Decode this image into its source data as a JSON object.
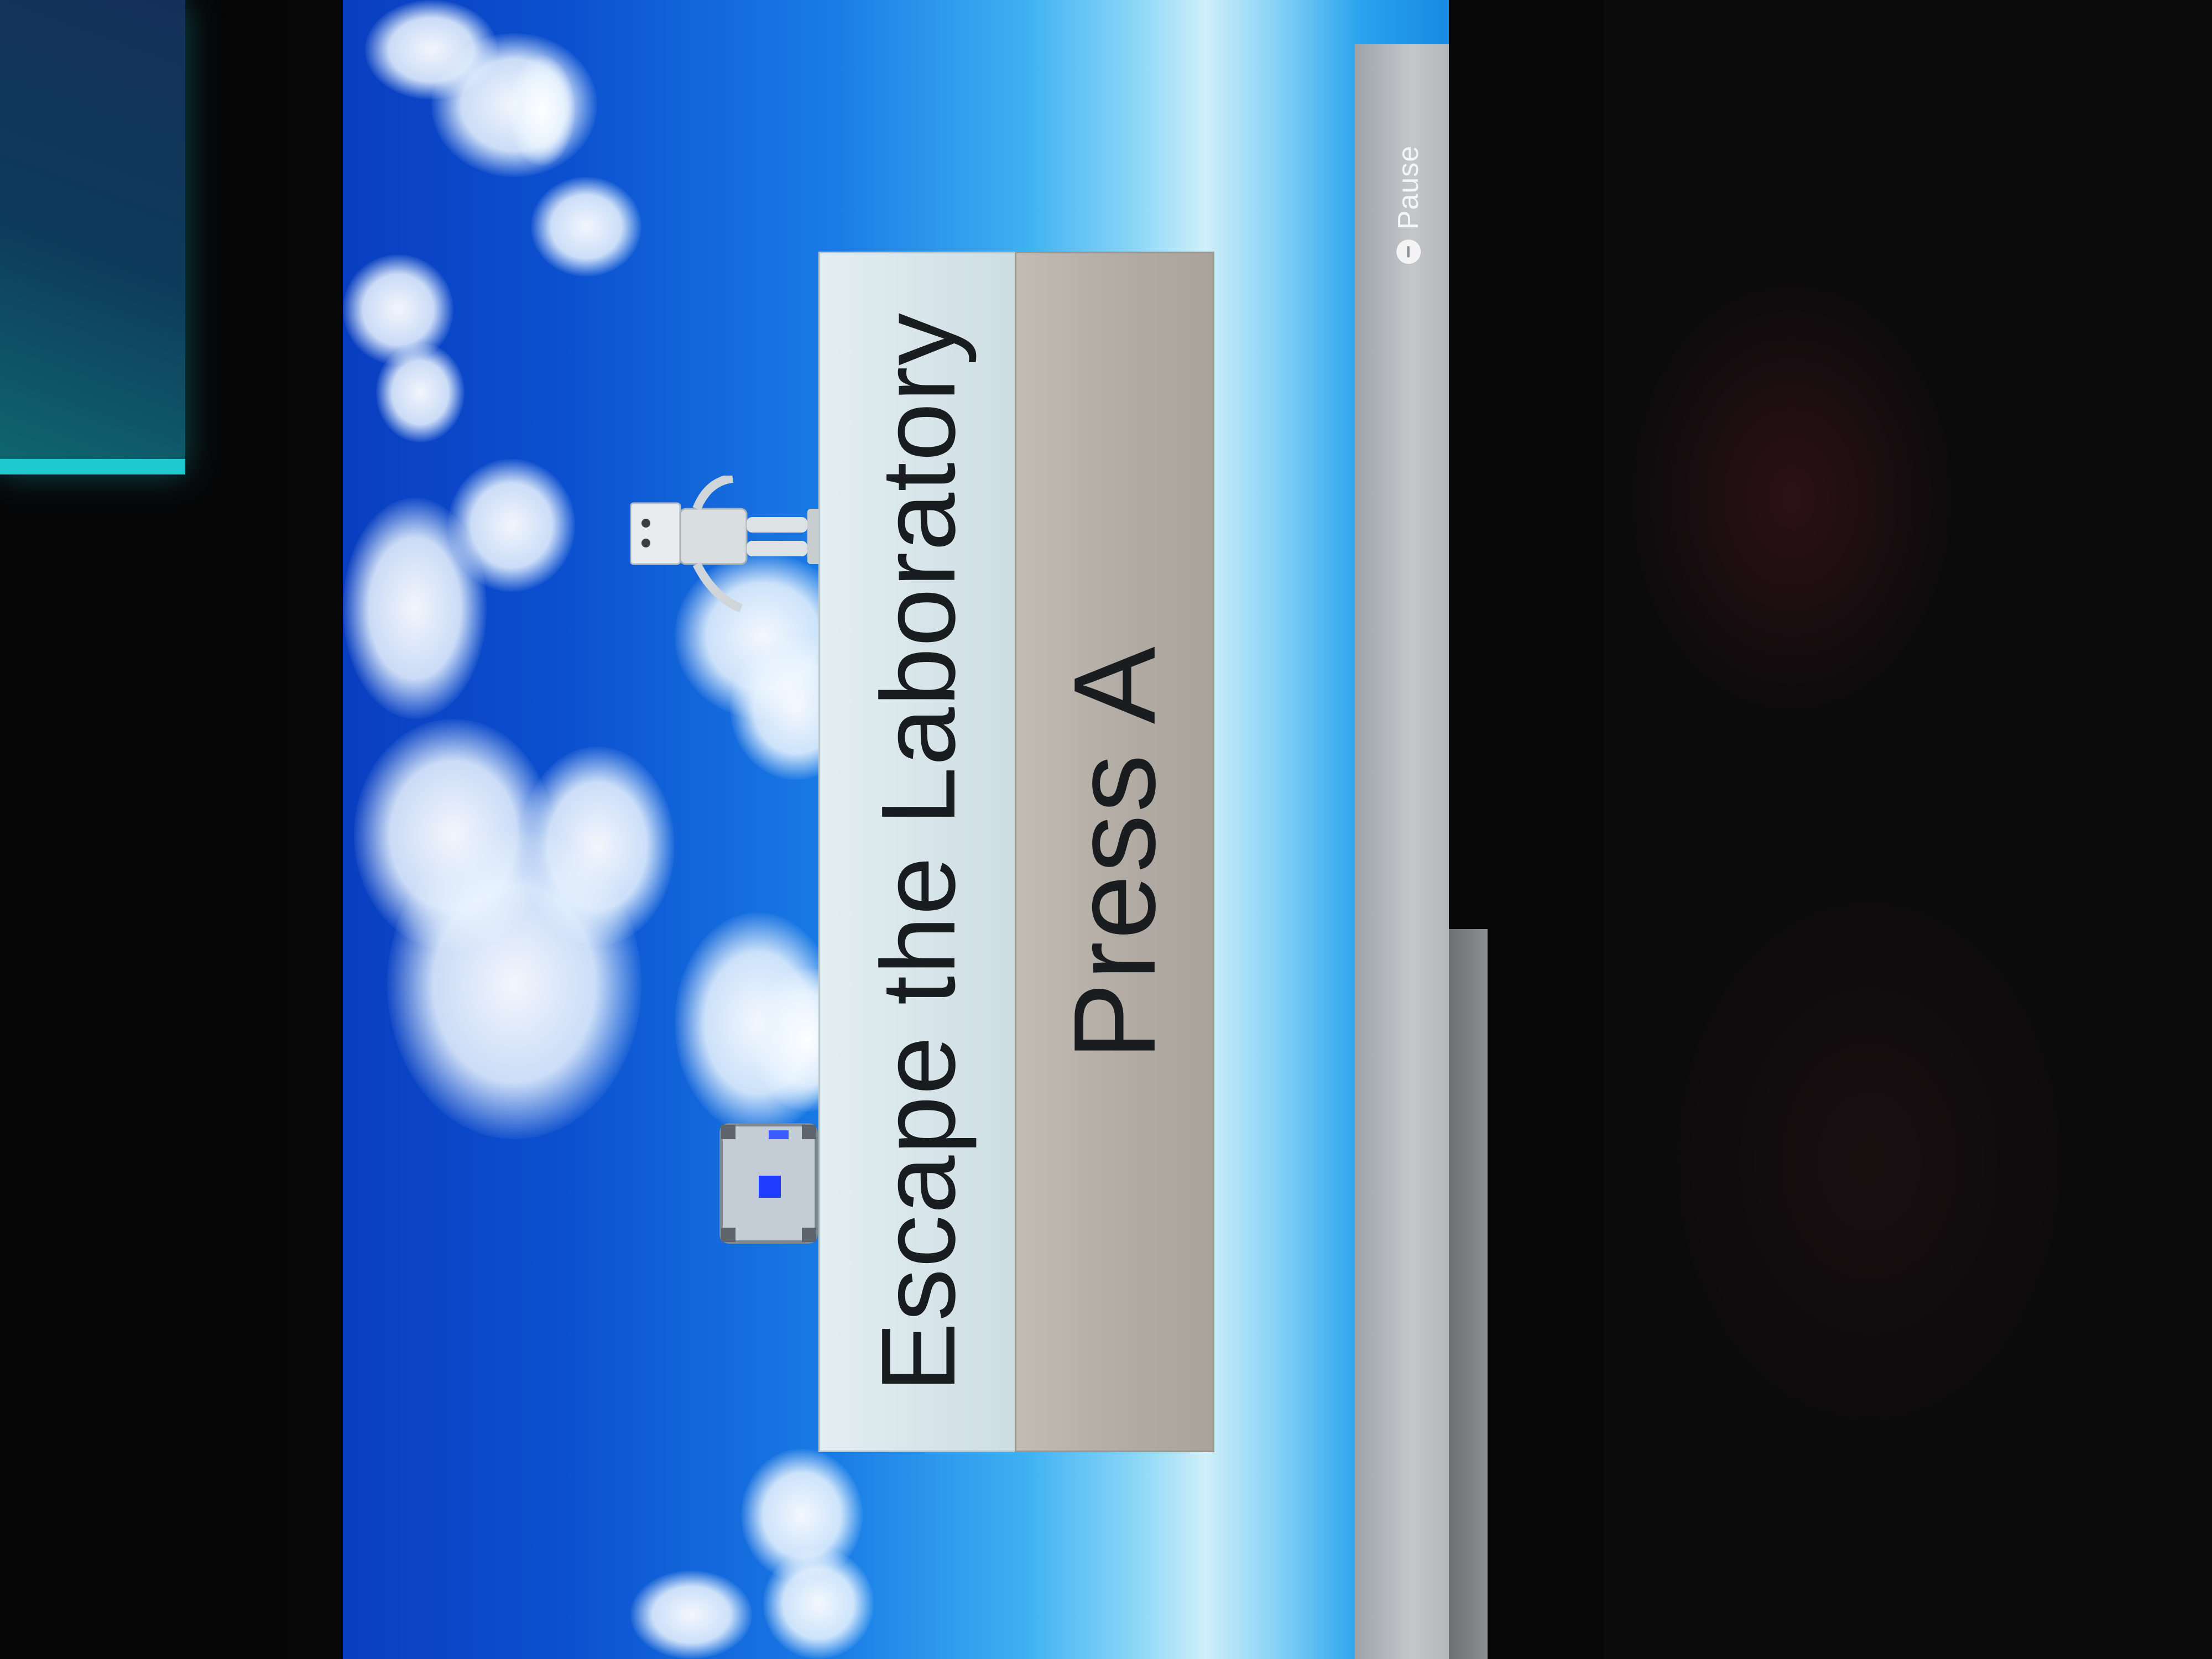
{
  "screen": {
    "title": "Escape the Laboratory",
    "prompt": "Press A"
  },
  "hud": {
    "pause_label": "Pause",
    "pause_button_glyph": "−",
    "pause_icon": "minus-button-icon"
  },
  "scene": {
    "background": "sky-with-clouds",
    "characters": [
      "robot-icon",
      "companion-cube-icon"
    ]
  },
  "colors": {
    "sky_deep": "#0a3ec0",
    "sky_horizon": "#cfeff9",
    "title_panel": "#d8e6ea",
    "prompt_panel": "#b3ada5",
    "text": "#1a1d1f",
    "cube_light": "#1f3cff"
  }
}
